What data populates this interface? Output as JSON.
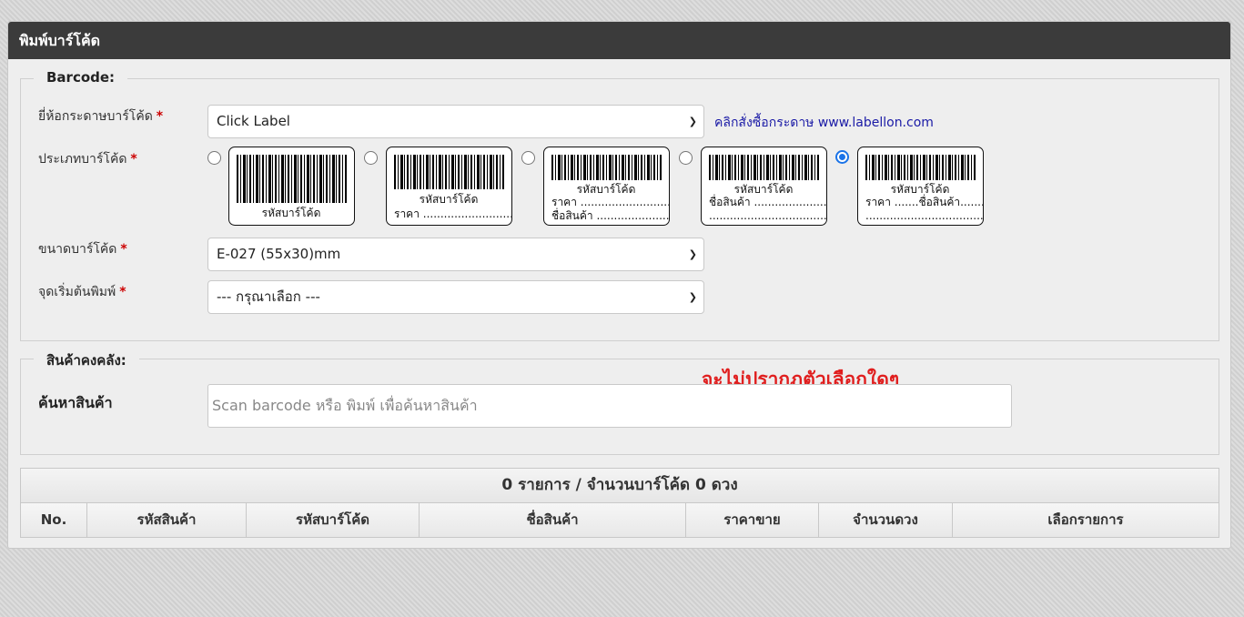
{
  "header": {
    "title": "พิมพ์บาร์โค้ด"
  },
  "barcode_section": {
    "legend": "Barcode:",
    "brand": {
      "label": "ยี่ห้อกระดาษบาร์โค้ด",
      "required_mark": "*",
      "value": "Click Label",
      "link_text": "คลิกสั่งซื้อกระดาษ www.labellon.com"
    },
    "type": {
      "label": "ประเภทบาร์โค้ด",
      "required_mark": "*",
      "selected_index": 4,
      "options": [
        {
          "lines": [
            "รหัสบาร์โค้ด"
          ]
        },
        {
          "lines": [
            "รหัสบาร์โค้ด",
            "ราคา ................................"
          ]
        },
        {
          "lines": [
            "รหัสบาร์โค้ด",
            "ราคา ................................",
            "ชื่อสินค้า ........................"
          ]
        },
        {
          "lines": [
            "รหัสบาร์โค้ด",
            "ชื่อสินค้า ........................",
            "..........................................."
          ]
        },
        {
          "lines": [
            "รหัสบาร์โค้ด",
            "ราคา .......ชื่อสินค้า.......",
            "..........................................."
          ]
        }
      ]
    },
    "size": {
      "label": "ขนาดบาร์โค้ด",
      "required_mark": "*",
      "value": "E-027 (55x30)mm"
    },
    "start_point": {
      "label": "จุดเริ่มต้นพิมพ์",
      "required_mark": "*",
      "value": "--- กรุณาเลือก ---"
    }
  },
  "stock_section": {
    "legend": "สินค้าคงคลัง:",
    "annotation": "จะไม่ปรากฏตัวเลือกใดๆ",
    "search_label": "ค้นหาสินค้า",
    "search_placeholder": "Scan barcode หรือ พิมพ์ เพื่อค้นหาสินค้า"
  },
  "table": {
    "summary": "0 รายการ / จำนวนบาร์โค้ด 0 ดวง",
    "columns": [
      "No.",
      "รหัสสินค้า",
      "รหัสบาร์โค้ด",
      "ชื่อสินค้า",
      "ราคาขาย",
      "จำนวนดวง",
      "เลือกรายการ"
    ]
  },
  "colors": {
    "header_bg": "#3b3b3b",
    "required": "#cc0000",
    "link": "#1a1aa6",
    "annotation": "#e01e1e",
    "radio_checked": "#1a73e8"
  },
  "icons": {
    "select_arrow": "chevron-down-icon"
  }
}
